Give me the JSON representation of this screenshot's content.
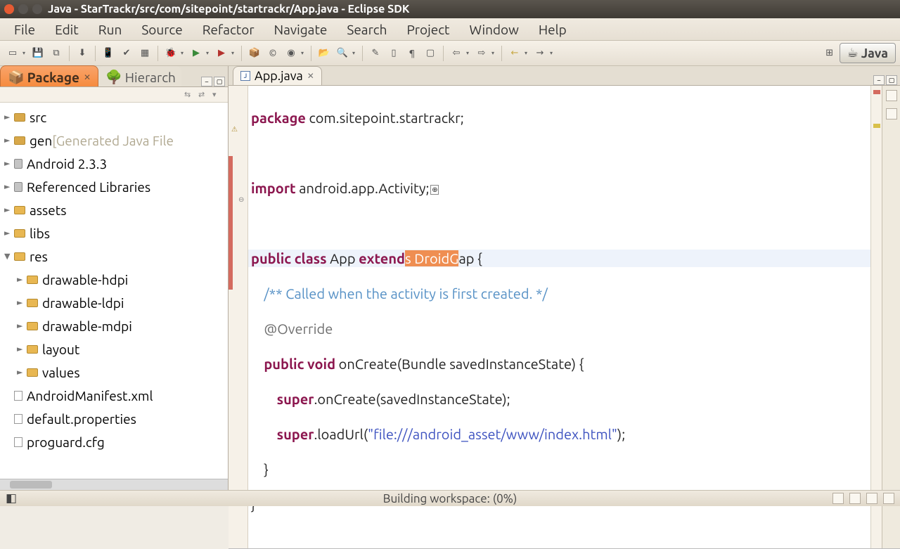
{
  "window": {
    "title": "Java - StarTrackr/src/com/sitepoint/startrackr/App.java - Eclipse SDK"
  },
  "menu": {
    "items": [
      "File",
      "Edit",
      "Run",
      "Source",
      "Refactor",
      "Navigate",
      "Search",
      "Project",
      "Window",
      "Help"
    ]
  },
  "perspective": {
    "label": "Java"
  },
  "left": {
    "tabs": {
      "active": "Package",
      "inactive": "Hierarch"
    },
    "tree": [
      {
        "level": 1,
        "icon": "pkg",
        "label": "src",
        "expander": "►"
      },
      {
        "level": 1,
        "icon": "pkg",
        "label": "gen",
        "expander": "►",
        "suffix": "[Generated Java File"
      },
      {
        "level": 1,
        "icon": "jar",
        "label": "Android 2.3.3",
        "expander": "►"
      },
      {
        "level": 1,
        "icon": "jar",
        "label": "Referenced Libraries",
        "expander": "►"
      },
      {
        "level": 1,
        "icon": "folder",
        "label": "assets",
        "expander": "►"
      },
      {
        "level": 1,
        "icon": "folder",
        "label": "libs",
        "expander": "►"
      },
      {
        "level": 1,
        "icon": "folder",
        "label": "res",
        "expander": "▼"
      },
      {
        "level": 2,
        "icon": "folder",
        "label": "drawable-hdpi",
        "expander": "►"
      },
      {
        "level": 2,
        "icon": "folder",
        "label": "drawable-ldpi",
        "expander": "►"
      },
      {
        "level": 2,
        "icon": "folder",
        "label": "drawable-mdpi",
        "expander": "►"
      },
      {
        "level": 2,
        "icon": "folder",
        "label": "layout",
        "expander": "►"
      },
      {
        "level": 2,
        "icon": "folder",
        "label": "values",
        "expander": "►"
      },
      {
        "level": 1,
        "icon": "file",
        "label": "AndroidManifest.xml",
        "expander": ""
      },
      {
        "level": 1,
        "icon": "file",
        "label": "default.properties",
        "expander": ""
      },
      {
        "level": 1,
        "icon": "file",
        "label": "proguard.cfg",
        "expander": ""
      }
    ]
  },
  "editor": {
    "tab": "App.java",
    "code": {
      "l1a": "package",
      "l1b": " com.sitepoint.startrackr;",
      "l2a": "import",
      "l2b": " android.app.Activity;",
      "l3a": "public",
      "l3b": "class",
      "l3c": " App ",
      "l3d": "extend",
      "l3hl": "s DroidG",
      "l3e": "ap {",
      "l4": "    /** Called when the activity is first created. */",
      "l5": "    @Override",
      "l6a": "    ",
      "l6b": "public",
      "l6c": "void",
      "l6d": " onCreate(Bundle savedInstanceState) {",
      "l7a": "        ",
      "l7b": "super",
      "l7c": ".onCreate(savedInstanceState);",
      "l8a": "        ",
      "l8b": "super",
      "l8c": ".loadUrl(",
      "l8d": "\"file:///android_asset/www/index.html\"",
      "l8e": ");",
      "l9": "    }",
      "l10": "}"
    }
  },
  "status": {
    "text": "Building workspace: (0%)"
  }
}
